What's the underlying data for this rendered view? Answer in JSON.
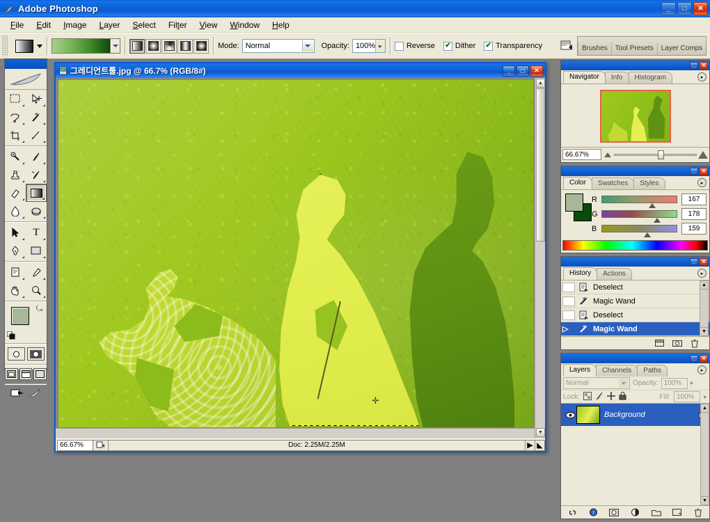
{
  "app": {
    "title": "Adobe Photoshop",
    "icon": "photoshop-feather-icon",
    "window_buttons": {
      "minimize": "_",
      "maximize": "□",
      "close": "✕"
    }
  },
  "menubar": {
    "items": [
      {
        "label": "File",
        "accel": "F"
      },
      {
        "label": "Edit",
        "accel": "E"
      },
      {
        "label": "Image",
        "accel": "I"
      },
      {
        "label": "Layer",
        "accel": "L"
      },
      {
        "label": "Select",
        "accel": "S"
      },
      {
        "label": "Filter",
        "accel": "t"
      },
      {
        "label": "View",
        "accel": "V"
      },
      {
        "label": "Window",
        "accel": "W"
      },
      {
        "label": "Help",
        "accel": "H"
      }
    ]
  },
  "options_bar": {
    "tool": "gradient-tool",
    "gradient_picker_label": "",
    "gradient_types": [
      {
        "name": "linear-gradient",
        "selected": true
      },
      {
        "name": "radial-gradient",
        "selected": false
      },
      {
        "name": "angle-gradient",
        "selected": false
      },
      {
        "name": "reflected-gradient",
        "selected": false
      },
      {
        "name": "diamond-gradient",
        "selected": false
      }
    ],
    "mode_label": "Mode:",
    "mode_value": "Normal",
    "opacity_label": "Opacity:",
    "opacity_value": "100%",
    "checkboxes": [
      {
        "label": "Reverse",
        "checked": false
      },
      {
        "label": "Dither",
        "checked": true
      },
      {
        "label": "Transparency",
        "checked": true
      }
    ],
    "palette_well": {
      "tabs": [
        "Brushes",
        "Tool Presets",
        "Layer Comps"
      ]
    }
  },
  "toolbox": {
    "tools": [
      "rectangular-marquee-tool",
      "move-tool",
      "lasso-tool",
      "magic-wand-tool",
      "crop-tool",
      "slice-tool",
      "healing-brush-tool",
      "brush-tool",
      "clone-stamp-tool",
      "history-brush-tool",
      "eraser-tool",
      "gradient-tool",
      "blur-tool",
      "dodge-tool",
      "path-selection-tool",
      "type-tool",
      "pen-tool",
      "rectangle-tool",
      "notes-tool",
      "eyedropper-tool",
      "hand-tool",
      "zoom-tool"
    ],
    "selected_tool": "gradient-tool",
    "foreground_color": "#a7b898",
    "background_color": "#0b4a0b",
    "quick_mask": [
      "standard-mode",
      "quick-mask-mode"
    ],
    "screen_modes": [
      "standard-screen-mode",
      "full-screen-with-menubar",
      "full-screen-mode"
    ],
    "jump_to": [
      "jump-to-imageready",
      "photoshop-icon"
    ]
  },
  "document": {
    "title": "그레디언트툴.jpg @ 66.7% (RGB/8#)",
    "filename": "그레디언트툴.jpg",
    "zoom": "66.7%",
    "mode": "RGB/8#",
    "window_buttons": {
      "minimize": "_",
      "maximize": "□",
      "close": "✕"
    },
    "statusbar": {
      "zoom": "66.67%",
      "doc_info": "Doc: 2.25M/2.25M"
    },
    "canvas": {
      "description": "green textured artwork with three woman silhouettes",
      "background_color": "#9ec81c",
      "selection_active": true,
      "selected_shape": "center-figure",
      "gradient_drag_line": true
    }
  },
  "palettes": {
    "navigator": {
      "tabs": [
        {
          "label": "Navigator",
          "active": true
        },
        {
          "label": "Info",
          "active": false
        },
        {
          "label": "Histogram",
          "active": false
        }
      ],
      "zoom_value": "66.67%",
      "view_box_color": "#e8614a"
    },
    "color": {
      "tabs": [
        {
          "label": "Color",
          "active": true
        },
        {
          "label": "Swatches",
          "active": false
        },
        {
          "label": "Styles",
          "active": false
        }
      ],
      "channels": [
        {
          "name": "R",
          "value": "167",
          "position": 65
        },
        {
          "name": "G",
          "value": "178",
          "position": 70
        },
        {
          "name": "B",
          "value": "159",
          "position": 62
        }
      ],
      "foreground": "#a7b898",
      "background": "#0b4a0b"
    },
    "history": {
      "tabs": [
        {
          "label": "History",
          "active": true
        },
        {
          "label": "Actions",
          "active": false
        }
      ],
      "states": [
        {
          "label": "Deselect",
          "icon": "deselect-icon",
          "selected": false
        },
        {
          "label": "Magic Wand",
          "icon": "magic-wand-icon",
          "selected": false
        },
        {
          "label": "Deselect",
          "icon": "deselect-icon",
          "selected": false
        },
        {
          "label": "Magic Wand",
          "icon": "magic-wand-icon",
          "selected": true
        }
      ],
      "footer_icons": [
        "new-document-from-state-icon",
        "new-snapshot-icon",
        "delete-state-icon"
      ]
    },
    "layers": {
      "tabs": [
        {
          "label": "Layers",
          "active": true
        },
        {
          "label": "Channels",
          "active": false
        },
        {
          "label": "Paths",
          "active": false
        }
      ],
      "blend_mode": "Normal",
      "opacity_label": "Opacity:",
      "opacity_value": "100%",
      "lock_label": "Lock:",
      "lock_icons": [
        "lock-transparent-pixels-icon",
        "lock-image-pixels-icon",
        "lock-position-icon",
        "lock-all-icon"
      ],
      "fill_label": "Fill:",
      "fill_value": "100%",
      "rows": [
        {
          "name": "Background",
          "visible": true,
          "locked": true,
          "selected": true
        }
      ],
      "footer_icons": [
        "link-layers-icon",
        "layer-style-icon",
        "layer-mask-icon",
        "adjustment-layer-icon",
        "new-group-icon",
        "new-layer-icon",
        "delete-layer-icon"
      ]
    }
  }
}
